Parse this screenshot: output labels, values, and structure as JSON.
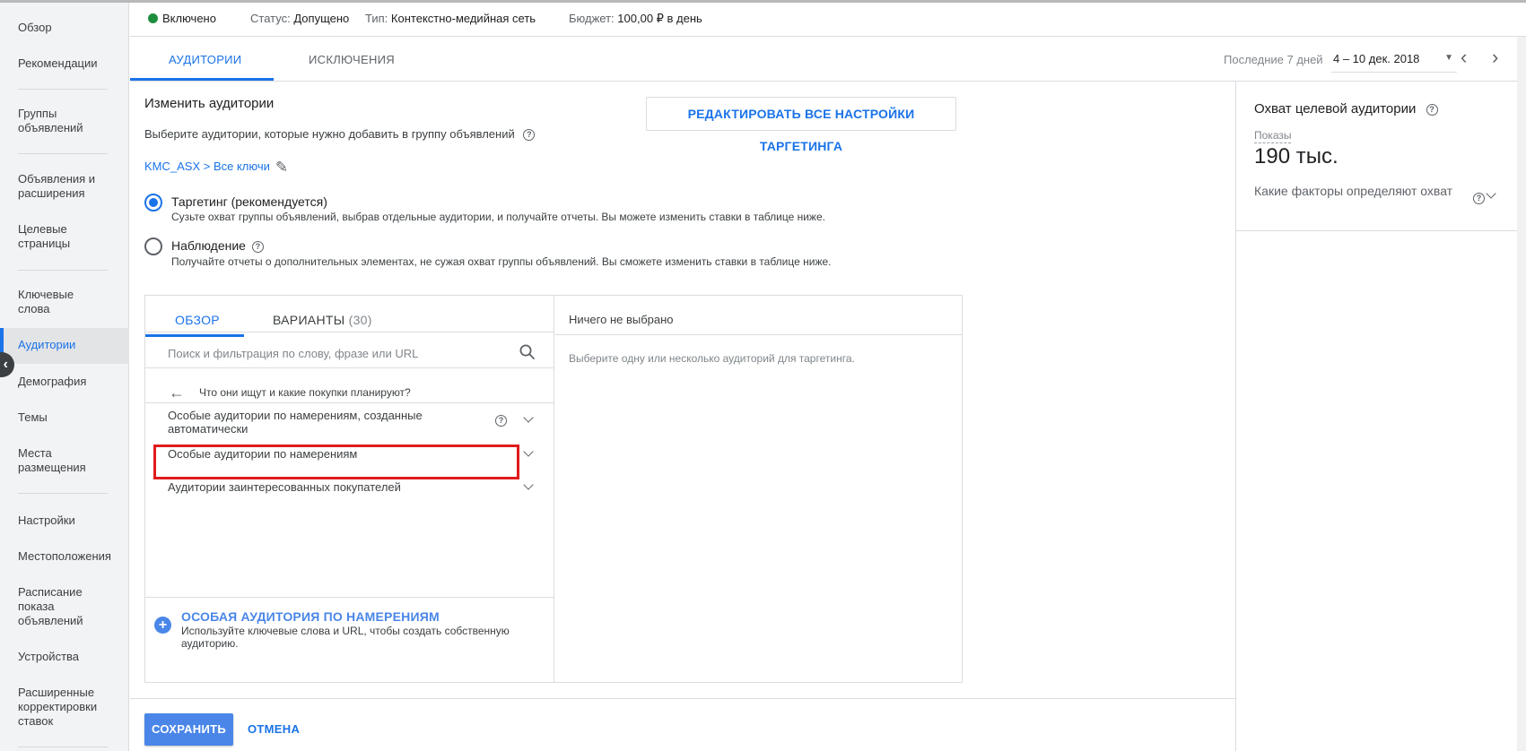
{
  "sidebar": {
    "items": [
      {
        "label": "Обзор"
      },
      {
        "label": "Рекомендации"
      },
      {
        "label": "Группы объявлений"
      },
      {
        "label": "Объявления и расширения"
      },
      {
        "label": "Целевые страницы"
      },
      {
        "label": "Ключевые слова"
      },
      {
        "label": "Аудитории",
        "active": true
      },
      {
        "label": "Демография"
      },
      {
        "label": "Темы"
      },
      {
        "label": "Места размещения"
      },
      {
        "label": "Настройки"
      },
      {
        "label": "Местоположения"
      },
      {
        "label": "Расписание показа объявлений"
      },
      {
        "label": "Устройства"
      },
      {
        "label": "Расширенные корректировки ставок"
      }
    ]
  },
  "statusbar": {
    "enabled": "Включено",
    "status_label": "Статус:",
    "status_value": "Допущено",
    "type_label": "Тип:",
    "type_value": "Контекстно-медийная сеть",
    "budget_label": "Бюджет:",
    "budget_value": "100,00 ₽ в день",
    "enabled_color": "#1e8e3e"
  },
  "tabs": {
    "audiences": "АУДИТОРИИ",
    "exclusions": "ИСКЛЮЧЕНИЯ",
    "date_label": "Последние 7 дней",
    "date_range": "4 – 10 дек. 2018"
  },
  "main": {
    "title": "Изменить аудитории",
    "subtitle": "Выберите аудитории, которые нужно добавить в группу объявлений",
    "breadcrumb": "KMC_ASX > Все ключи",
    "edit_all_button": "РЕДАКТИРОВАТЬ ВСЕ НАСТРОЙКИ ТАРГЕТИНГА",
    "targeting": {
      "title": "Таргетинг (рекомендуется)",
      "desc": "Сузьте охват группы объявлений, выбрав отдельные аудитории, и получайте отчеты. Вы можете изменить ставки в таблице ниже.",
      "selected": true
    },
    "observation": {
      "title": "Наблюдение",
      "desc": "Получайте отчеты о дополнительных элементах, не сужая охват группы объявлений. Вы сможете изменить ставки в таблице ниже.",
      "selected": false
    }
  },
  "panel": {
    "tab_overview": "ОБЗОР",
    "tab_variants": "ВАРИАНТЫ",
    "variants_count": "(30)",
    "search_placeholder": "Поиск и фильтрация по слову, фразе или URL",
    "back_text": "Что они ищут и какие покупки планируют?",
    "categories": [
      {
        "label": "Особые аудитории по намерениям, созданные автоматически"
      },
      {
        "label": "Особые аудитории по намерениям",
        "highlighted": true
      },
      {
        "label": "Аудитории заинтересованных покупателей"
      }
    ],
    "add_title": "ОСОБАЯ АУДИТОРИЯ ПО НАМЕРЕНИЯМ",
    "add_desc": "Используйте ключевые слова и URL, чтобы создать собственную аудиторию.",
    "right_head": "Ничего не выбрано",
    "right_hint": "Выберите одну или несколько аудиторий для таргетинга."
  },
  "footer": {
    "save": "СОХРАНИТЬ",
    "cancel": "ОТМЕНА"
  },
  "reach": {
    "title": "Охват целевой аудитории",
    "impressions_label": "Показы",
    "impressions_value": "190 тыс.",
    "factors": "Какие факторы определяют охват"
  },
  "colors": {
    "accent": "#1a73e8",
    "button": "#4a86e8",
    "highlight_box": "#e01b1b"
  }
}
